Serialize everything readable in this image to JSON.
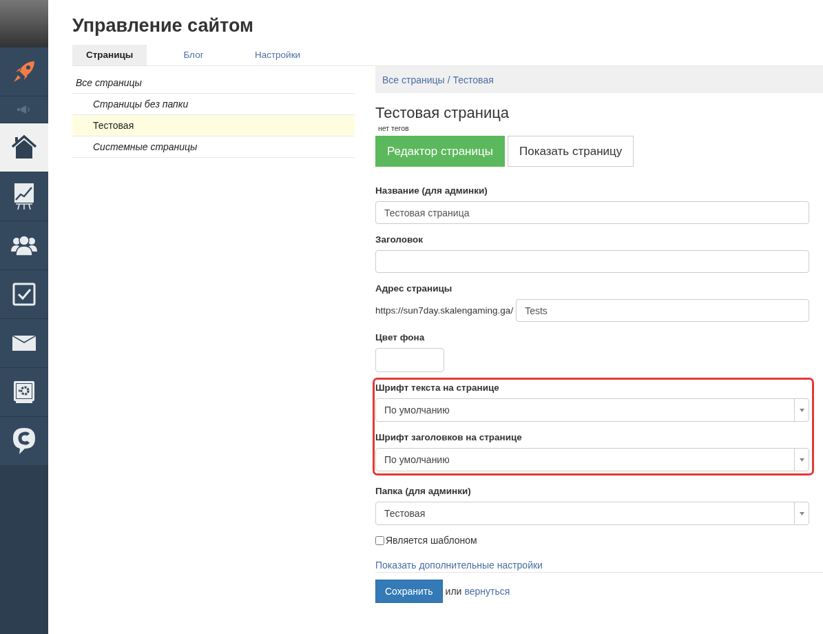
{
  "sidebar": {
    "items": [
      {
        "kind": "rocket",
        "selected": false
      },
      {
        "kind": "speaker",
        "selected": false
      },
      {
        "kind": "home",
        "selected": true
      },
      {
        "kind": "chart",
        "selected": false
      },
      {
        "kind": "users",
        "selected": false
      },
      {
        "kind": "check",
        "selected": false
      },
      {
        "kind": "mail",
        "selected": false
      },
      {
        "kind": "safe",
        "selected": false
      },
      {
        "kind": "chat",
        "selected": false
      }
    ]
  },
  "title": "Управление сайтом",
  "tabs": [
    {
      "label": "Страницы",
      "selected": true
    },
    {
      "label": "Блог",
      "selected": false
    },
    {
      "label": "Настройки",
      "selected": false
    }
  ],
  "tree": [
    {
      "label": "Все страницы",
      "kind": "folder",
      "selected": false,
      "children": [
        {
          "label": "Страницы без папки",
          "kind": "folder",
          "selected": false
        },
        {
          "label": "Тестовая",
          "kind": "page",
          "selected": true
        },
        {
          "label": "Системные страницы",
          "kind": "folder",
          "selected": false
        }
      ]
    }
  ],
  "breadcrumb": [
    {
      "label": "Все страницы"
    },
    {
      "label": "Тестовая"
    }
  ],
  "breadcrumb_separator": "/",
  "page_title": "Тестовая страница",
  "tags": "нет тегов",
  "actions": [
    {
      "label": "Редактор страницы",
      "kind": "primary"
    },
    {
      "label": "Показать страницу",
      "kind": "default"
    }
  ],
  "fields": [
    {
      "kind": "text",
      "label": "Название (для админки)",
      "value": "Тестовая страница"
    },
    {
      "kind": "text",
      "label": "Заголовок"
    },
    {
      "kind": "url",
      "label": "Адрес страницы",
      "prefix": "https://sun7day.skalengaming.ga/",
      "value": "Tests"
    },
    {
      "kind": "color",
      "label": "Цвет фона"
    },
    {
      "kind": "highlight",
      "fields": [
        {
          "kind": "select",
          "label": "Шрифт текста на странице",
          "value": "По умолчанию"
        },
        {
          "kind": "select",
          "label": "Шрифт заголовков на странице",
          "value": "По умолчанию"
        }
      ]
    },
    {
      "kind": "select",
      "label": "Папка (для админки)",
      "value": "Тестовая"
    },
    {
      "kind": "checkbox",
      "label": "Является шаблоном",
      "checked": false
    }
  ],
  "more_link": "Показать дополнительные настройки",
  "save_button": "Сохранить",
  "or_text": "или",
  "back_link": "вернуться"
}
